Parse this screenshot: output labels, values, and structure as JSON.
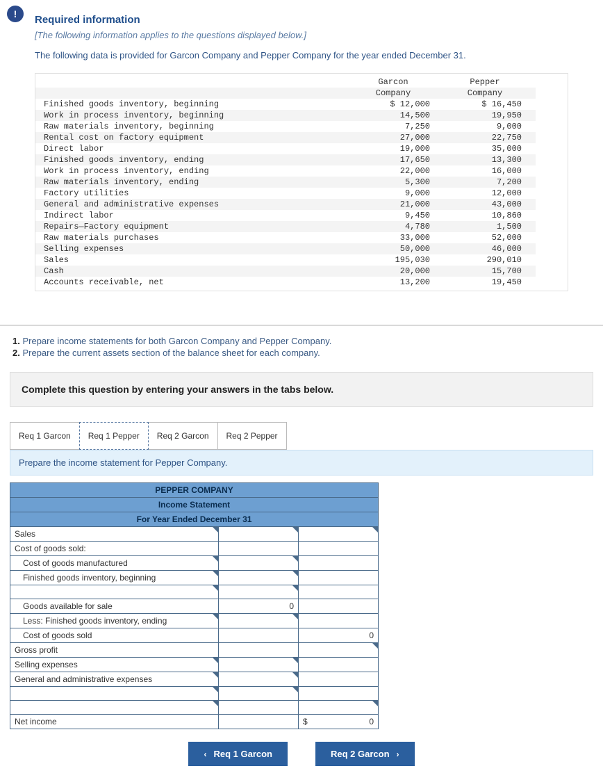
{
  "badge": "!",
  "req_title": "Required information",
  "italic_note": "[The following information applies to the questions displayed below.]",
  "intro_text": "The following data is provided for Garcon Company and Pepper Company for the year ended December 31.",
  "data_headers": {
    "c1": "Garcon Company",
    "c2": "Pepper Company"
  },
  "data_rows": [
    {
      "label": "Finished goods inventory, beginning",
      "c1": "$ 12,000",
      "c2": "$ 16,450"
    },
    {
      "label": "Work in process inventory, beginning",
      "c1": "14,500",
      "c2": "19,950"
    },
    {
      "label": "Raw materials inventory, beginning",
      "c1": "7,250",
      "c2": "9,000"
    },
    {
      "label": "Rental cost on factory equipment",
      "c1": "27,000",
      "c2": "22,750"
    },
    {
      "label": "Direct labor",
      "c1": "19,000",
      "c2": "35,000"
    },
    {
      "label": "Finished goods inventory, ending",
      "c1": "17,650",
      "c2": "13,300"
    },
    {
      "label": "Work in process inventory, ending",
      "c1": "22,000",
      "c2": "16,000"
    },
    {
      "label": "Raw materials inventory, ending",
      "c1": "5,300",
      "c2": "7,200"
    },
    {
      "label": "Factory utilities",
      "c1": "9,000",
      "c2": "12,000"
    },
    {
      "label": "General and administrative expenses",
      "c1": "21,000",
      "c2": "43,000"
    },
    {
      "label": "Indirect labor",
      "c1": "9,450",
      "c2": "10,860"
    },
    {
      "label": "Repairs—Factory equipment",
      "c1": "4,780",
      "c2": "1,500"
    },
    {
      "label": "Raw materials purchases",
      "c1": "33,000",
      "c2": "52,000"
    },
    {
      "label": "Selling expenses",
      "c1": "50,000",
      "c2": "46,000"
    },
    {
      "label": "Sales",
      "c1": "195,030",
      "c2": "290,010"
    },
    {
      "label": "Cash",
      "c1": "20,000",
      "c2": "15,700"
    },
    {
      "label": "Accounts receivable, net",
      "c1": "13,200",
      "c2": "19,450"
    }
  ],
  "tasks": {
    "n1": "1.",
    "t1": "Prepare income statements for both Garcon Company and Pepper Company.",
    "n2": "2.",
    "t2": "Prepare the current assets section of the balance sheet for each company."
  },
  "instr_box": "Complete this question by entering your answers in the tabs below.",
  "tabs": [
    {
      "label": "Req 1 Garcon"
    },
    {
      "label": "Req 1 Pepper"
    },
    {
      "label": "Req 2 Garcon"
    },
    {
      "label": "Req 2 Pepper"
    }
  ],
  "sub_instr": "Prepare the income statement for Pepper Company.",
  "answer_header": {
    "company": "PEPPER COMPANY",
    "title": "Income Statement",
    "period": "For Year Ended December 31"
  },
  "answer_rows": {
    "sales": "Sales",
    "cogs_hdr": "Cost of goods sold:",
    "cogm": "Cost of goods manufactured",
    "fg_beg": "Finished goods inventory, beginning",
    "gafs": "Goods available for sale",
    "gafs_val": "0",
    "less_fg_end": "Less: Finished goods inventory, ending",
    "cogs": "Cost of goods sold",
    "cogs_val": "0",
    "gp": "Gross profit",
    "sell_exp": "Selling expenses",
    "ga_exp": "General and administrative expenses",
    "ni": "Net income",
    "ni_cur": "$",
    "ni_val": "0"
  },
  "nav": {
    "prev": "Req 1 Garcon",
    "next": "Req 2 Garcon"
  }
}
